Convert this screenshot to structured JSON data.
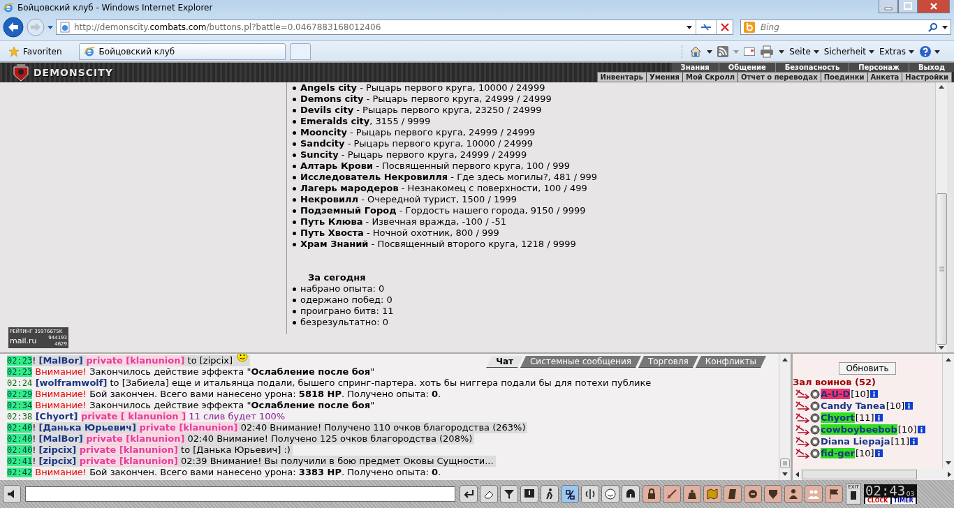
{
  "browser": {
    "title": "Бойцовский клуб - Windows Internet Explorer",
    "url": {
      "prefix": "http://demonscity.",
      "domain": "combats.com",
      "suffix": "/buttons.pl?battle=0.0467883168012406"
    },
    "search": {
      "placeholder": "Bing"
    },
    "favorites": "Favoriten",
    "tab": "Бойцовский клуб",
    "commands": [
      "Seite",
      "Sicherheit",
      "Extras"
    ]
  },
  "game_header": {
    "logo": "DEMONSCITY",
    "menu": [
      "Знания",
      "Общение",
      "Безопасность",
      "Персонаж",
      "Выход"
    ],
    "submenu": [
      "Инвентарь",
      "Умения",
      "Мой Скролл",
      "Отчет о переводах",
      "Поединки",
      "Анкета",
      "Настройки"
    ]
  },
  "rating": {
    "label": "РЕЙТИНГ 35976675K",
    "logo": "mail.ru",
    "hits": "944193",
    "hosts": "4629"
  },
  "reputation": [
    "**Angels city** - Рыцарь первого круга, 10000 / 24999",
    "**Demons city** - Рыцарь первого круга, 24999 / 24999",
    "**Devils city** - Рыцарь первого круга, 23250 / 24999",
    "**Emeralds city**, 3155 / 9999",
    "**Mooncity** - Рыцарь первого круга, 24999 / 24999",
    "**Sandcity** - Рыцарь первого круга, 10000 / 24999",
    "**Suncity** - Рыцарь первого круга, 24999 / 24999",
    "**Алтарь Крови** - Посвященный первого круга, 100 / 999",
    "**Исследователь Некровилля** - Где здесь могилы?, 481 / 999",
    "**Лагерь мародеров** - Незнакомец с поверхности, 100 / 499",
    "**Некровилл** - Очередной турист, 1500 / 1999",
    "**Подземный Город** - Гордость нашего города, 9150 / 9999",
    "**Путь Клюва** - Извечная вражда, -100 / -51",
    "**Путь Хвоста** - Ночной охотник, 800 / 999",
    "**Храм Знаний** - Посвященный второго круга, 1218 / 9999"
  ],
  "today": {
    "title": "За сегодня",
    "items": [
      "набрано опыта: 0",
      "одержано побед: 0",
      "проиграно битв: 11",
      "безрезультатно: 0"
    ]
  },
  "chat_tabs": [
    {
      "label": "Чат",
      "selected": true
    },
    {
      "label": "Системные сообщения",
      "selected": false
    },
    {
      "label": "Торговля",
      "selected": false
    },
    {
      "label": "Конфликты",
      "selected": false
    }
  ],
  "chat": [
    {
      "time": "02:23",
      "time_marked": true,
      "highlighted": true,
      "smiley": true,
      "segments": [
        {
          "kind": "plain",
          "text": "! "
        },
        {
          "kind": "name",
          "text": "[MalBor] "
        },
        {
          "kind": "private",
          "text": "private [klanunion]"
        },
        {
          "kind": "plain",
          "text": " to [zipcix]"
        }
      ]
    },
    {
      "time": "02:23",
      "time_marked": true,
      "highlighted": false,
      "smiley": false,
      "segments": [
        {
          "kind": "alert",
          "text": " Внимание!"
        },
        {
          "kind": "plain",
          "text": " Закончилось действие эффекта \""
        },
        {
          "kind": "bold",
          "text": "Ослабление после боя"
        },
        {
          "kind": "plain",
          "text": "\""
        }
      ]
    },
    {
      "time": "02:24",
      "time_marked": false,
      "highlighted": false,
      "smiley": false,
      "segments": [
        {
          "kind": "name",
          "text": " [wolframwolf]"
        },
        {
          "kind": "plain",
          "text": " to [Забиела] еще и итальянца подали, бышего спринг-партера. хоть бы ниггера подали бы для потехи публике"
        }
      ]
    },
    {
      "time": "02:29",
      "time_marked": true,
      "highlighted": false,
      "smiley": false,
      "segments": [
        {
          "kind": "alert",
          "text": " Внимание!"
        },
        {
          "kind": "plain",
          "text": " Бой закончен. Всего вами нанесено урона: "
        },
        {
          "kind": "bold",
          "text": "5818 HP"
        },
        {
          "kind": "plain",
          "text": ". Получено опыта: "
        },
        {
          "kind": "bold",
          "text": "0"
        },
        {
          "kind": "plain",
          "text": "."
        }
      ]
    },
    {
      "time": "02:34",
      "time_marked": true,
      "highlighted": false,
      "smiley": false,
      "segments": [
        {
          "kind": "alert",
          "text": " Внимание!"
        },
        {
          "kind": "plain",
          "text": " Закончилось действие эффекта \""
        },
        {
          "kind": "bold",
          "text": "Ослабление после боя"
        },
        {
          "kind": "plain",
          "text": "\""
        }
      ]
    },
    {
      "time": "02:38",
      "time_marked": false,
      "highlighted": false,
      "smiley": false,
      "segments": [
        {
          "kind": "name",
          "text": " [Chyort] "
        },
        {
          "kind": "private",
          "text": "private [ klanunion ]"
        },
        {
          "kind": "clan",
          "text": " 11 слив будет 100%"
        }
      ]
    },
    {
      "time": "02:40",
      "time_marked": true,
      "highlighted": true,
      "smiley": false,
      "segments": [
        {
          "kind": "plain",
          "text": "! "
        },
        {
          "kind": "name",
          "text": "[Данька Юрьевич] "
        },
        {
          "kind": "private",
          "text": "private [klanunion]"
        },
        {
          "kind": "plain",
          "text": " 02:40 Внимание! Получено 110 очков благородства (263%)"
        }
      ]
    },
    {
      "time": "02:40",
      "time_marked": true,
      "highlighted": true,
      "smiley": false,
      "segments": [
        {
          "kind": "plain",
          "text": "! "
        },
        {
          "kind": "name",
          "text": "[MalBor] "
        },
        {
          "kind": "private",
          "text": "private [klanunion]"
        },
        {
          "kind": "plain",
          "text": " 02:40 Внимание! Получено 125 очков благородства (208%)"
        }
      ]
    },
    {
      "time": "02:40",
      "time_marked": true,
      "highlighted": true,
      "smiley": false,
      "segments": [
        {
          "kind": "plain",
          "text": "! "
        },
        {
          "kind": "name",
          "text": "[zipcix] "
        },
        {
          "kind": "private",
          "text": "private [klanunion]"
        },
        {
          "kind": "plain",
          "text": " to [Данька Юрьевич] :)"
        }
      ]
    },
    {
      "time": "02:41",
      "time_marked": true,
      "highlighted": true,
      "smiley": false,
      "segments": [
        {
          "kind": "plain",
          "text": "! "
        },
        {
          "kind": "name",
          "text": "[zipcix] "
        },
        {
          "kind": "private",
          "text": "private [klanunion]"
        },
        {
          "kind": "plain",
          "text": " 02:39 Внимание! Вы получили в бою предмет Оковы Сущности..."
        }
      ]
    },
    {
      "time": "02:42",
      "time_marked": true,
      "highlighted": false,
      "smiley": false,
      "segments": [
        {
          "kind": "alert",
          "text": " Внимание!"
        },
        {
          "kind": "plain",
          "text": " Бой закончен. Всего вами нанесено урона: "
        },
        {
          "kind": "bold",
          "text": "3383 HP"
        },
        {
          "kind": "plain",
          "text": ". Получено опыта: "
        },
        {
          "kind": "bold",
          "text": "0"
        },
        {
          "kind": "plain",
          "text": "."
        }
      ]
    }
  ],
  "users_panel": {
    "refresh": "Обновить",
    "title": "Зал воинов (52)",
    "users": [
      {
        "name": "A-U-D",
        "level": "[10]",
        "color": "#f0306a"
      },
      {
        "name": "Candy Tanea",
        "level": "[10]"
      },
      {
        "name": "Chyort",
        "level": "[11]",
        "color": "#33dd22"
      },
      {
        "name": "cowboybeebob",
        "level": "[10]",
        "color": "#33dd22"
      },
      {
        "name": "Diana Liepaja",
        "level": "[11]"
      },
      {
        "name": "fid-ger",
        "level": "[10]",
        "color": "#33dd22"
      }
    ]
  },
  "bottom_bar": {
    "exit": "EXIT",
    "clock": "02:43",
    "seconds": "03",
    "clock_label": "CLOCK",
    "timer_label": "TIMER"
  }
}
